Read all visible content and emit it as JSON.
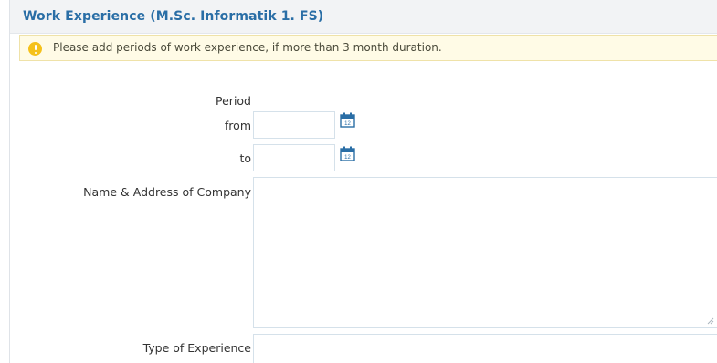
{
  "section": {
    "title": "Work Experience (M.Sc. Informatik 1. FS)"
  },
  "notice": {
    "icon": "info-warning-icon",
    "color": "#f5c11a",
    "text": "Please add periods of work experience, if more than 3 month duration."
  },
  "form": {
    "period_label": "Period",
    "from_label": "from",
    "from_value": "",
    "to_label": "to",
    "to_value": "",
    "company_label": "Name & Address of Company",
    "company_value": "",
    "type_label": "Type of Experience",
    "type_value": ""
  },
  "colors": {
    "title": "#2a6ea6",
    "calendar": "#2a6ea6",
    "field_border": "#d5e1ea"
  }
}
